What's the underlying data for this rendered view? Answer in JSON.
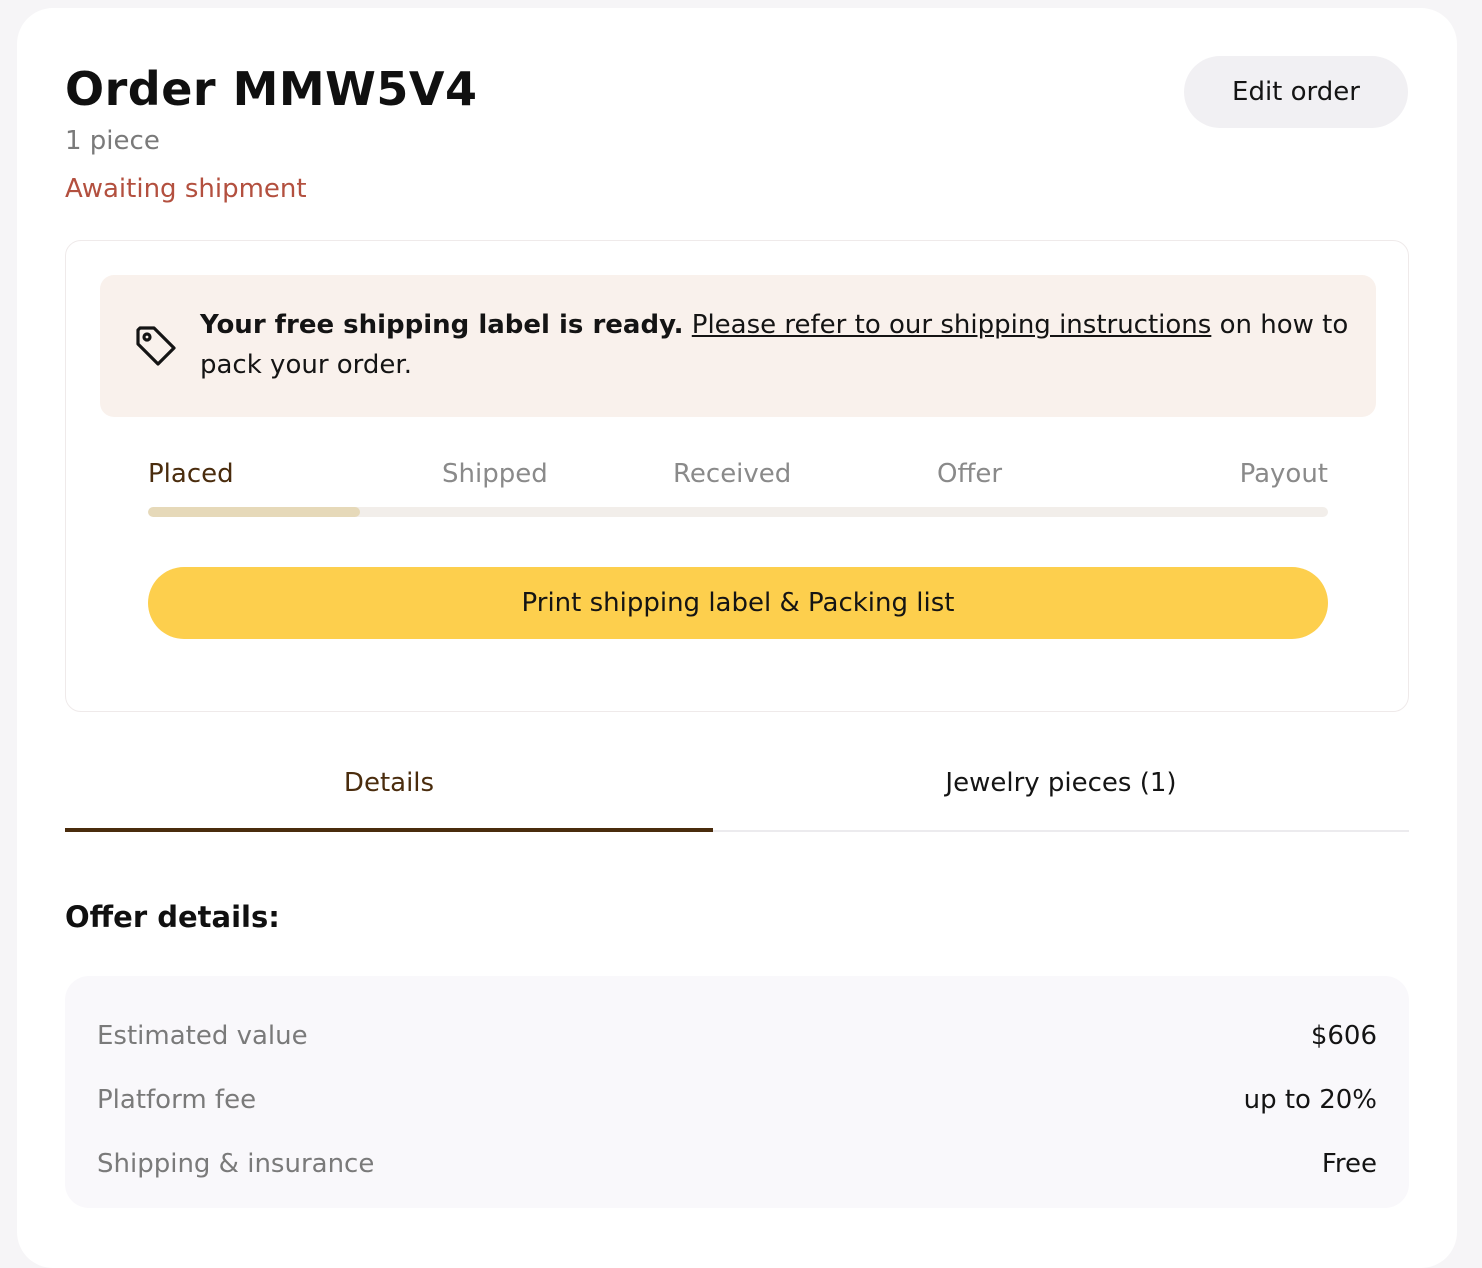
{
  "header": {
    "title": "Order MMW5V4",
    "subtitle": "1 piece",
    "status": "Awaiting shipment",
    "edit_label": "Edit order"
  },
  "notice": {
    "icon": "tag-icon",
    "lead": "Your free shipping label is ready.",
    "link": "Please refer to our shipping instructions",
    "tail": "on how to pack your order."
  },
  "progress": {
    "steps": [
      "Placed",
      "Shipped",
      "Received",
      "Offer",
      "Payout"
    ],
    "current_step": "Placed",
    "fill_fraction": 0.18
  },
  "print_label": "Print shipping label & Packing list",
  "tabs": {
    "details": "Details",
    "jewelry": "Jewelry pieces (1)",
    "active": "Details"
  },
  "offer": {
    "title": "Offer details:",
    "rows": [
      {
        "label": "Estimated value",
        "value": "$606"
      },
      {
        "label": "Platform fee",
        "value": "up to 20%"
      },
      {
        "label": "Shipping & insurance",
        "value": "Free"
      }
    ]
  },
  "colors": {
    "status": "#b3503f",
    "accent": "#fdcf4d",
    "active_tab": "#4a2c0d",
    "notice_bg": "#f9f1ec"
  }
}
